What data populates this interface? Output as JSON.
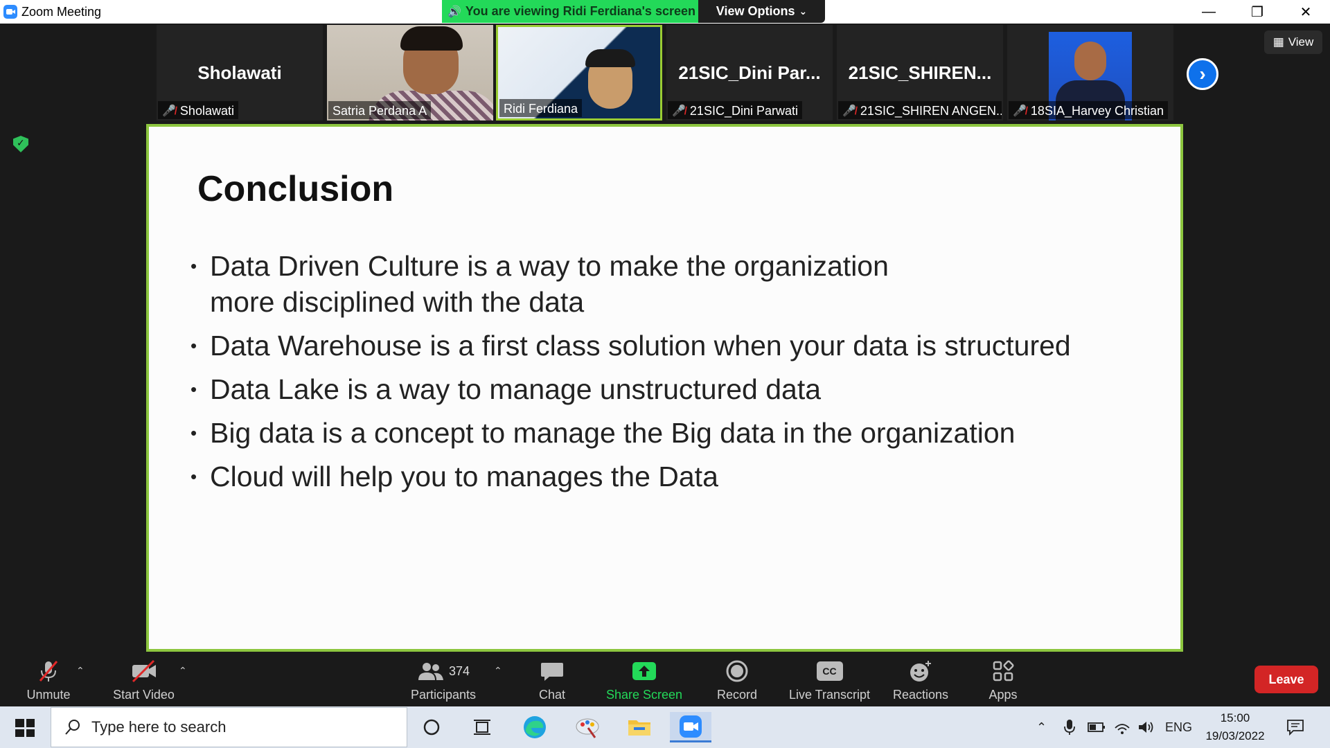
{
  "window": {
    "title": "Zoom Meeting",
    "viewing_banner": "You are viewing Ridi Ferdiana's screen",
    "view_options": "View Options"
  },
  "thumbnails": [
    {
      "big_name": "Sholawati",
      "label": "Sholawati",
      "muted": true,
      "kind": "name"
    },
    {
      "big_name": "",
      "label": "Satria Perdana A",
      "muted": false,
      "kind": "video1"
    },
    {
      "big_name": "",
      "label": "Ridi Ferdiana",
      "muted": false,
      "kind": "video2"
    },
    {
      "big_name": "21SIC_Dini  Par...",
      "label": "21SIC_Dini Parwati",
      "muted": true,
      "kind": "name"
    },
    {
      "big_name": "21SIC_SHIREN...",
      "label": "21SIC_SHIREN ANGEN...",
      "muted": true,
      "kind": "name"
    },
    {
      "big_name": "",
      "label": "18SIA_Harvey Christian",
      "muted": true,
      "kind": "photo"
    }
  ],
  "view_button": "View",
  "slide": {
    "title": "Conclusion",
    "bullets": [
      "Data Driven Culture is a way to make the organization more disciplined with the data",
      "Data Warehouse is a first class solution when your data is structured",
      "Data Lake is a way to manage unstructured data",
      "Big data is a concept to manage the Big data in the organization",
      "Cloud will help you to manages the Data"
    ]
  },
  "toolbar": {
    "unmute": "Unmute",
    "start_video": "Start Video",
    "participants": "Participants",
    "participant_count": "374",
    "chat": "Chat",
    "share_screen": "Share Screen",
    "record": "Record",
    "live_transcript": "Live Transcript",
    "reactions": "Reactions",
    "apps": "Apps",
    "leave": "Leave",
    "cc_text": "CC"
  },
  "taskbar": {
    "search_placeholder": "Type here to search",
    "language": "ENG",
    "time": "15:00",
    "date": "19/03/2022"
  },
  "colors": {
    "accent_green": "#23d959",
    "frame_green": "#8dc63f",
    "leave_red": "#d32525",
    "zoom_blue": "#0e71eb"
  }
}
